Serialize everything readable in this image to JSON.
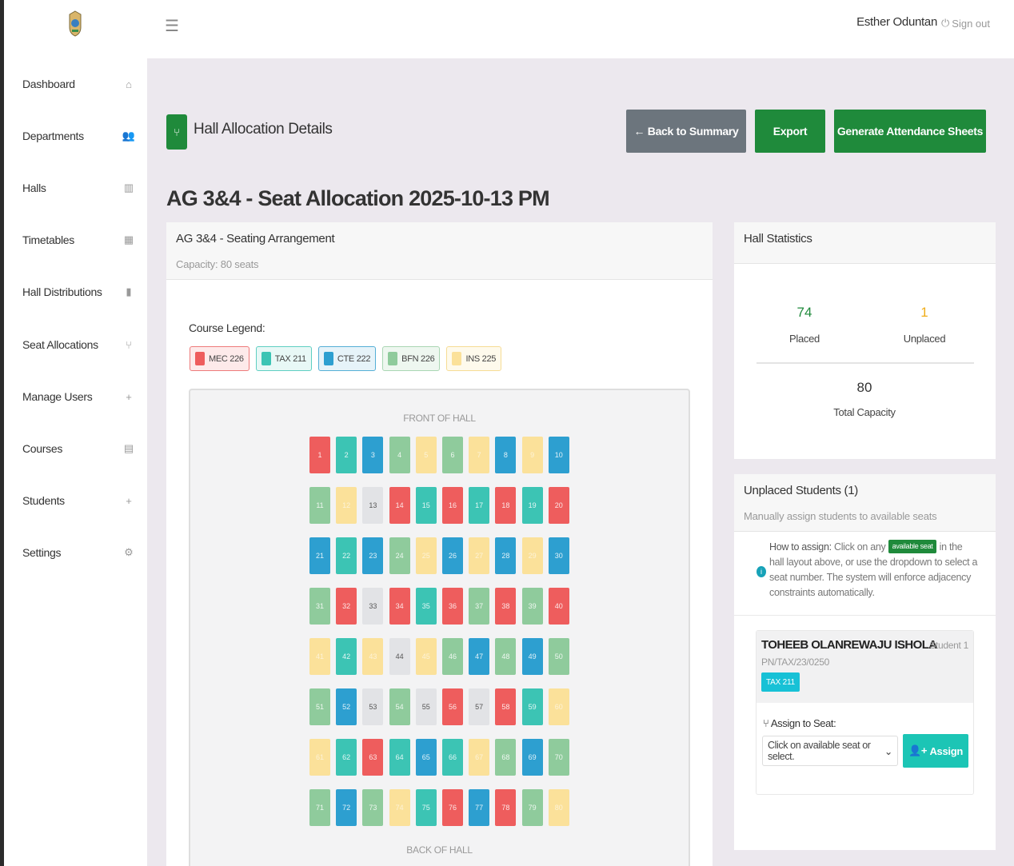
{
  "topbar": {
    "user_name": "Esther Oduntan",
    "signout_label": "Sign out"
  },
  "sidebar": {
    "items": [
      {
        "label": "Dashboard",
        "icon": "home-icon"
      },
      {
        "label": "Departments",
        "icon": "users-icon"
      },
      {
        "label": "Halls",
        "icon": "building-icon"
      },
      {
        "label": "Timetables",
        "icon": "calendar-icon"
      },
      {
        "label": "Hall Distributions",
        "icon": "bar-chart-icon"
      },
      {
        "label": "Seat Allocations",
        "icon": "chair-icon"
      },
      {
        "label": "Manage Users",
        "icon": "user-plus-icon"
      },
      {
        "label": "Courses",
        "icon": "file-icon"
      },
      {
        "label": "Students",
        "icon": "user-plus-icon"
      },
      {
        "label": "Settings",
        "icon": "gear-icon"
      }
    ]
  },
  "header": {
    "title": "Hall Allocation Details",
    "back_label": "← Back to Summary",
    "export_label": "Export",
    "generate_label": "Generate Attendance Sheets"
  },
  "page_title": "AG 3&4 - Seat Allocation 2025-10-13 PM",
  "seating": {
    "title": "AG 3&4 - Seating Arrangement",
    "capacity": "Capacity: 80 seats",
    "legend_title": "Course Legend:",
    "front_label": "FRONT OF HALL",
    "back_label": "BACK OF HALL"
  },
  "legend": [
    {
      "code": "MEC 226",
      "color": "#ee5d5d",
      "bg": "#fdeaea",
      "border": "#ee7b7b"
    },
    {
      "code": "TAX 211",
      "color": "#3cc4b4",
      "bg": "#e8f8f6",
      "border": "#5fcfc2"
    },
    {
      "code": "CTE 222",
      "color": "#2d9fd0",
      "bg": "#e6f3f9",
      "border": "#55afd6"
    },
    {
      "code": "BFN 226",
      "color": "#8fcb9c",
      "bg": "#eef7f0",
      "border": "#a9d6b3"
    },
    {
      "code": "INS 225",
      "color": "#fbe19a",
      "bg": "#fefaec",
      "border": "#f6dc95"
    }
  ],
  "colors": {
    "M": "#ee5d5d",
    "T": "#3cc4b4",
    "C": "#2d9fd0",
    "B": "#8fcb9c",
    "I": "#fbe19a",
    "E": "#e2e3e6"
  },
  "seat_rows": [
    "MTCBIBICIC",
    "BIEMTMTMTM",
    "CTCBICICIC",
    "BMEMTMBMBM",
    "ITIEIBCBCB",
    "BCEBEMEMTI",
    "ITMTCTIBCB",
    "BCBITMCMBI"
  ],
  "stats": {
    "title": "Hall Statistics",
    "placed": "74",
    "placed_label": "Placed",
    "unplaced": "1",
    "unplaced_label": "Unplaced",
    "total": "80",
    "total_label": "Total Capacity",
    "placed_color": "#1f8a3b",
    "unplaced_color": "#f0ad1a"
  },
  "unplaced": {
    "title": "Unplaced Students (1)",
    "subtitle": "Manually assign students to available seats",
    "how_label": "How to assign:",
    "how_pre": " Click on any ",
    "badge": "available seat",
    "how_post": " in the hall layout above, or use the dropdown to select a seat number. The system will enforce adjacency constraints automatically.",
    "student": {
      "name": "TOHEEB OLANREWAJU ISHOLA",
      "tag": "Student 1",
      "reg": "PN/TAX/23/0250",
      "course": "TAX 211"
    },
    "assign_label": "Assign to Seat:",
    "select_placeholder": "Click on available seat or select.",
    "assign_button": "Assign"
  }
}
